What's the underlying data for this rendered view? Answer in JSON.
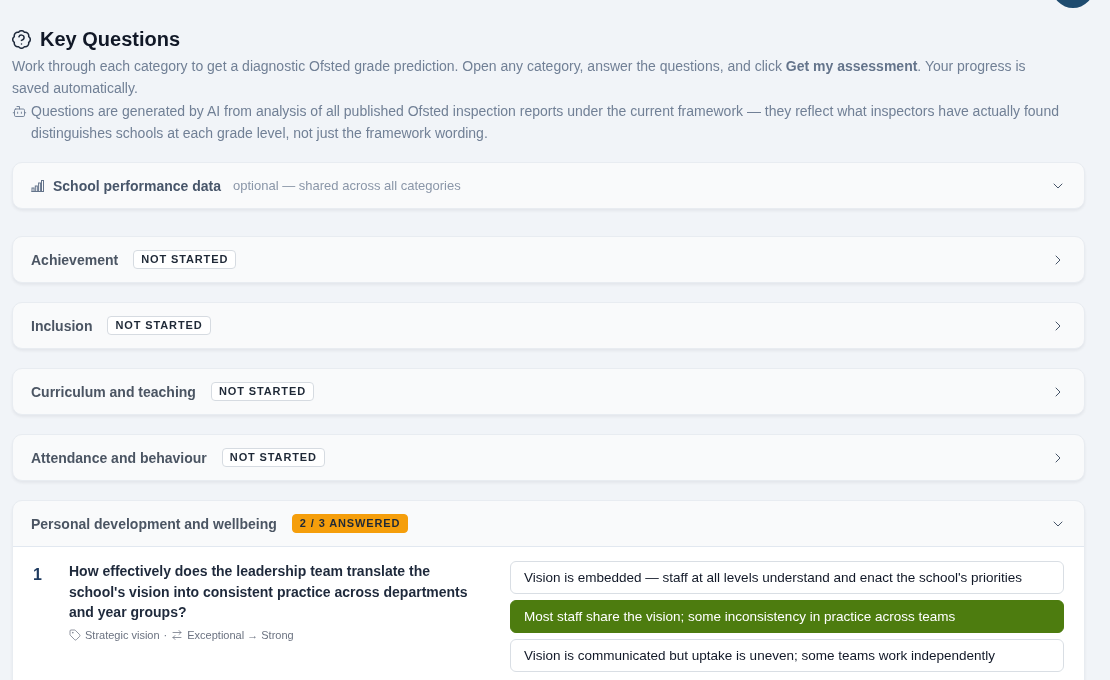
{
  "header": {
    "title": "Key Questions",
    "intro": "Work through each category to get a diagnostic Ofsted grade prediction. Open any category, answer the questions, and click **Get my assessment**. Your progress is saved automatically.",
    "ai_note": "Questions are generated by AI from analysis of all published Ofsted inspection reports under the current framework — they reflect what inspectors have actually found distinguishes schools at each grade level, not just the framework wording."
  },
  "performance_data": {
    "title": "School performance data",
    "subtitle": "optional — shared across all categories"
  },
  "categories": [
    {
      "name": "Achievement",
      "status": {
        "text": "NOT STARTED",
        "kind": "pending"
      },
      "expanded": false
    },
    {
      "name": "Inclusion",
      "status": {
        "text": "NOT STARTED",
        "kind": "pending"
      },
      "expanded": false
    },
    {
      "name": "Curriculum and teaching",
      "status": {
        "text": "NOT STARTED",
        "kind": "pending"
      },
      "expanded": false
    },
    {
      "name": "Attendance and behaviour",
      "status": {
        "text": "NOT STARTED",
        "kind": "pending"
      },
      "expanded": false
    },
    {
      "name": "Personal development and wellbeing",
      "status": {
        "text": "2 / 3 ANSWERED",
        "kind": "partial"
      },
      "expanded": true,
      "questions": [
        {
          "number": "1",
          "text": "How effectively does the leadership team translate the school's vision into consistent practice across departments and year groups?",
          "theme": "Strategic vision",
          "separator": "·",
          "grade_boundary": "Exceptional → Strong",
          "options": [
            {
              "text": "Vision is embedded — staff at all levels understand and enact the school's priorities",
              "selected": false
            },
            {
              "text": "Most staff share the vision; some inconsistency in practice across teams",
              "selected": true
            },
            {
              "text": "Vision is communicated but uptake is uneven; some teams work independently",
              "selected": false
            }
          ]
        }
      ]
    }
  ]
}
